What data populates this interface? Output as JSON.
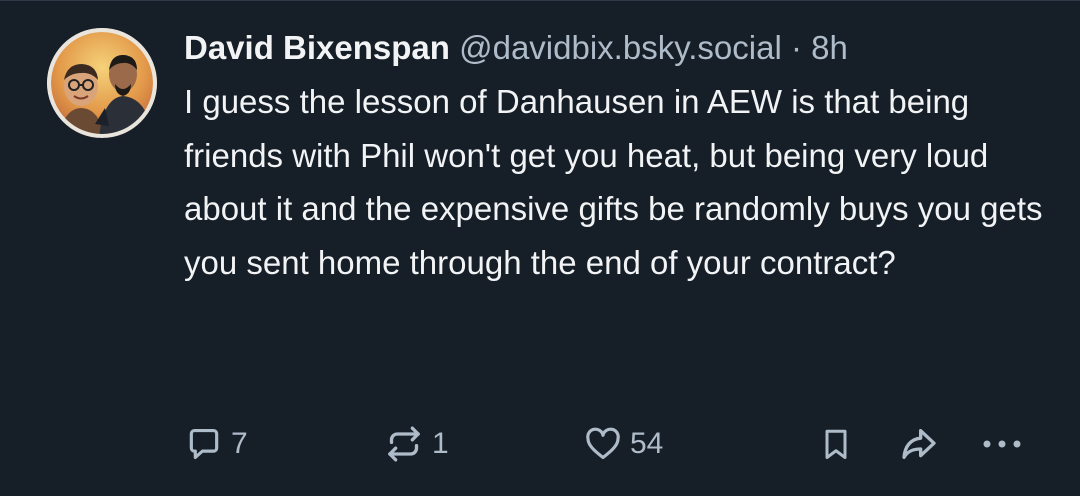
{
  "post": {
    "author": {
      "display_name": "David Bixenspan",
      "handle": "@davidbix.bsky.social",
      "avatar_icon": "avatar-photo"
    },
    "separator": "·",
    "timestamp": "8h",
    "text": "I guess the lesson of Danhausen in AEW is that being friends with Phil won't get you heat, but being very loud about it and the expensive gifts be randomly buys you gets you sent home through the end of your contract?",
    "actions": {
      "reply": {
        "icon": "reply-icon",
        "count": "7"
      },
      "repost": {
        "icon": "repost-icon",
        "count": "1"
      },
      "like": {
        "icon": "heart-icon",
        "count": "54"
      },
      "bookmark": {
        "icon": "bookmark-icon"
      },
      "share": {
        "icon": "share-icon"
      },
      "more": {
        "icon": "more-icon"
      }
    }
  },
  "colors": {
    "background": "#161e27",
    "text": "#f1f3f5",
    "muted": "#aebbc9"
  }
}
